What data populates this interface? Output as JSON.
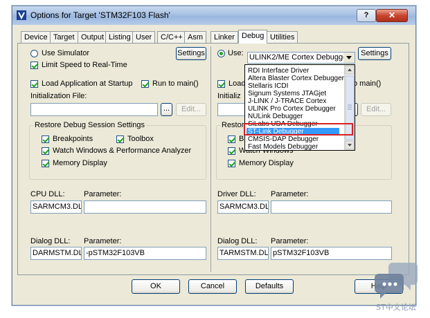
{
  "window": {
    "title": "Options for Target 'STM32F103 Flash'",
    "help_glyph": "?",
    "close_glyph": "✕"
  },
  "tabs": [
    "Device",
    "Target",
    "Output",
    "Listing",
    "User",
    "C/C++",
    "Asm",
    "Linker",
    "Debug",
    "Utilities"
  ],
  "active_tab": "Debug",
  "left": {
    "use_simulator": "Use Simulator",
    "limit_speed": "Limit Speed to Real-Time",
    "settings": "Settings",
    "load_app": "Load Application at Startup",
    "run_to_main": "Run to main()",
    "init_file": "Initialization File:",
    "browse": "...",
    "edit": "Edit...",
    "restore_title": "Restore Debug Session Settings",
    "breakpoints": "Breakpoints",
    "toolbox": "Toolbox",
    "watch_windows": "Watch Windows & Performance Analyzer",
    "memory_display": "Memory Display",
    "cpu_dll": "CPU DLL:",
    "cpu_param": "Parameter:",
    "cpu_dll_value": "SARMCM3.DLL",
    "cpu_param_value": "",
    "dialog_dll": "Dialog DLL:",
    "dialog_param": "Parameter:",
    "dialog_dll_value": "DARMSTM.DLL",
    "dialog_param_value": "-pSTM32F103VB"
  },
  "right": {
    "use": "Use:",
    "debugger_selected": "ULINK2/ME Cortex Debugger",
    "settings": "Settings",
    "load_partial": "Load",
    "run_to_main_partial": "o main()",
    "init_partial": "Initializ",
    "browse": "...",
    "edit": "Edit...",
    "restore_partial": "Restor",
    "br_partial": "Br",
    "watch_windows": "Watch Windows",
    "memory_display": "Memory Display",
    "driver_dll": "Driver DLL:",
    "driver_param": "Parameter:",
    "driver_dll_value": "SARMCM3.DLL",
    "driver_param_value": "",
    "dialog_dll": "Dialog DLL:",
    "dialog_param": "Parameter:",
    "dialog_dll_value": "TARMSTM.DLL",
    "dialog_param_value": "pSTM32F103VB"
  },
  "dropdown_items": [
    "RDI Interface Driver",
    "Altera Blaster Cortex Debugger",
    "Stellaris ICDI",
    "Signum Systems JTAGjet",
    "J-LINK / J-TRACE Cortex",
    "ULINK Pro Cortex Debugger",
    "NULink Debugger",
    "SiLabs UDA Debugger",
    "ST-Link Debugger",
    "CMSIS-DAP Debugger",
    "Fast Models Debugger"
  ],
  "highlighted_item": "ST-Link Debugger",
  "footer": {
    "ok": "OK",
    "cancel": "Cancel",
    "defaults": "Defaults",
    "help": "Help"
  },
  "watermark": {
    "text": "ST中文论坛"
  }
}
